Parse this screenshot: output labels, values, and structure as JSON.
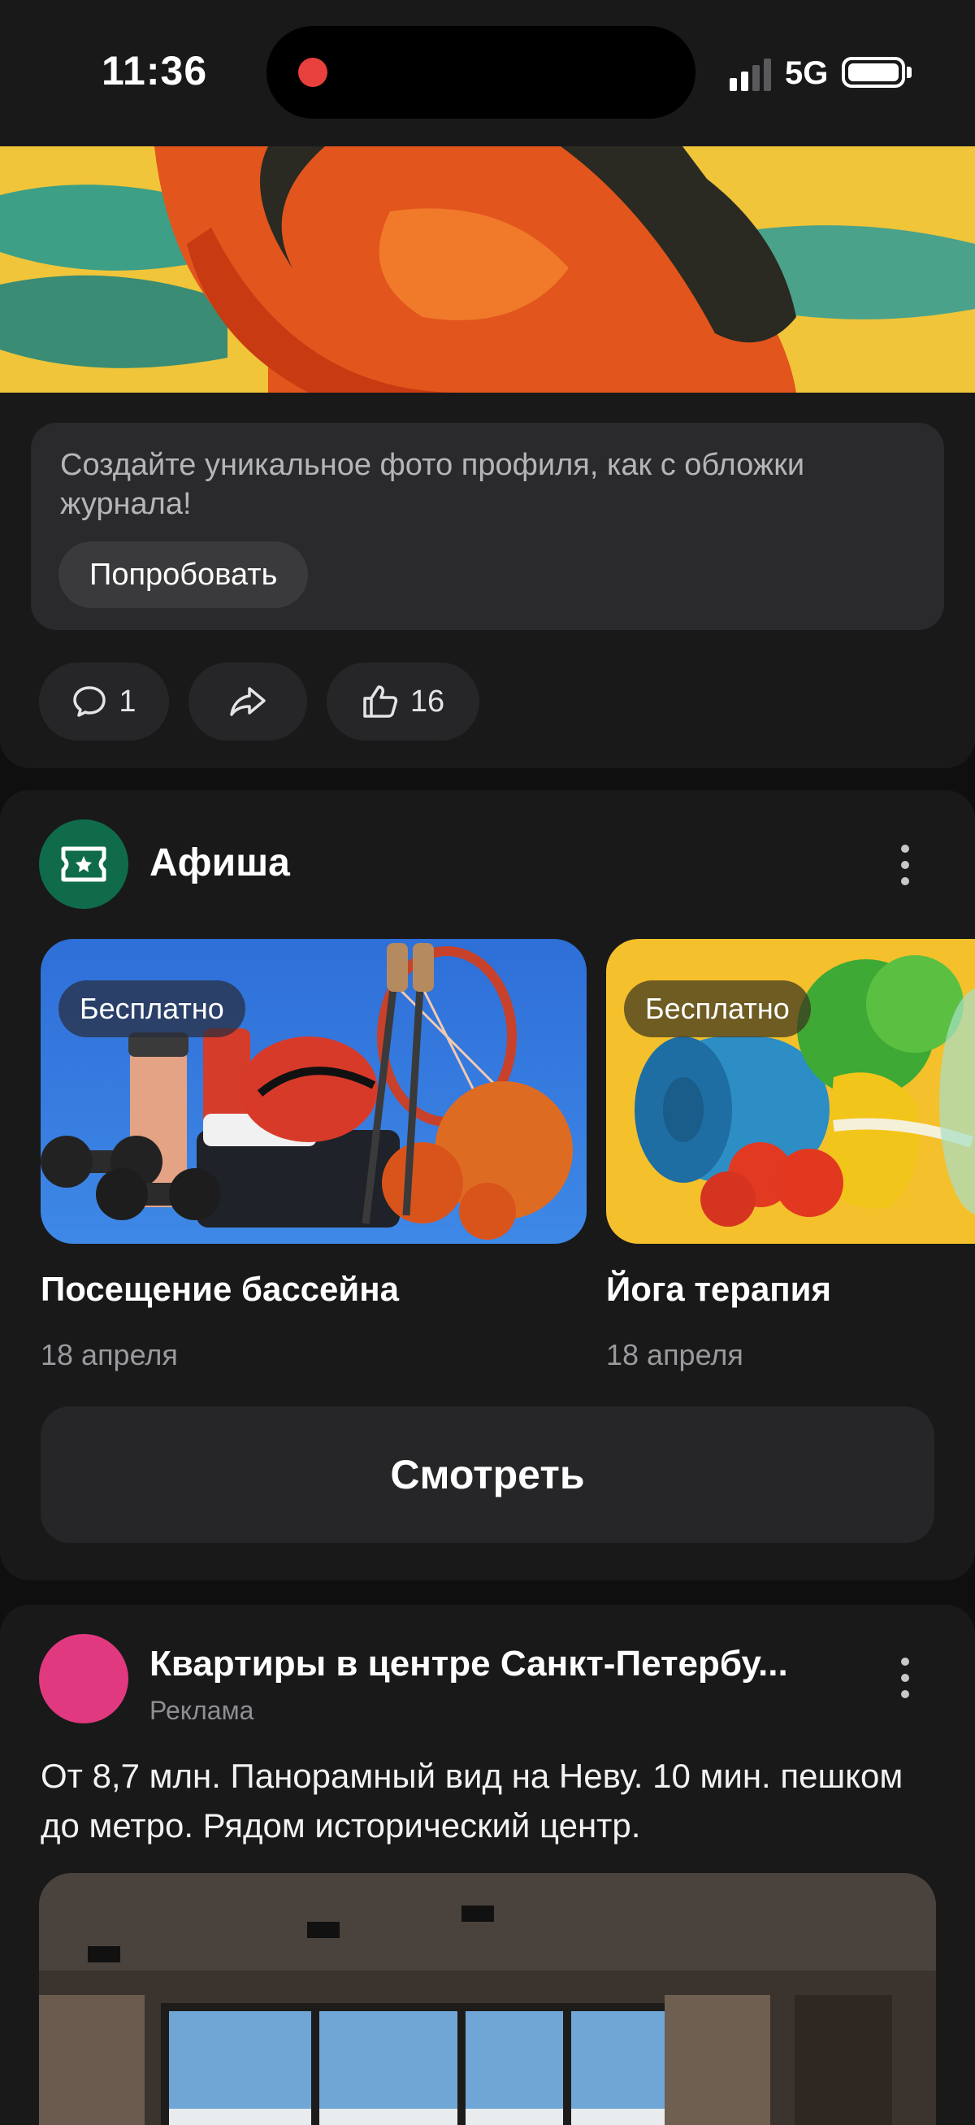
{
  "status_bar": {
    "time": "11:36",
    "network": "5G"
  },
  "post": {
    "prompt_text": "Создайте уникальное фото профиля, как с обложки журнала!",
    "try_label": "Попробовать",
    "comments_count": "1",
    "likes_count": "16"
  },
  "afisha": {
    "title": "Афиша",
    "events": [
      {
        "badge": "Бесплатно",
        "title": "Посещение бассейна",
        "date": "18 апреля"
      },
      {
        "badge": "Бесплатно",
        "title": "Йога терапия",
        "date": "18 апреля"
      }
    ],
    "watch_label": "Смотреть"
  },
  "ad": {
    "title": "Квартиры в центре Санкт-Петербу...",
    "label": "Реклама",
    "text": "От 8,7 млн. Панорамный вид на Неву. 10 мин. пешком до метро. Рядом исторический центр."
  },
  "colors": {
    "background": "#0f0f10",
    "card": "#19191a",
    "afisha_logo": "#0f6b49",
    "ad_avatar": "#e0397f",
    "recording_dot": "#e8403c"
  }
}
